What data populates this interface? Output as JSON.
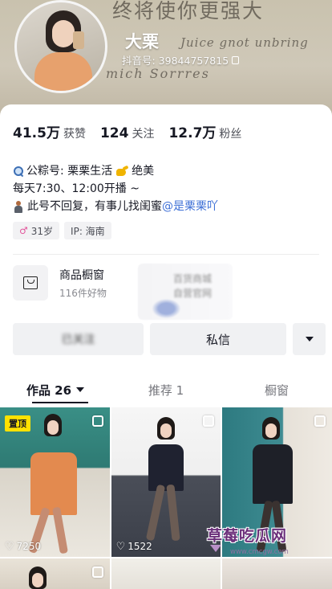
{
  "header": {
    "handwriting": [
      "终将使你更强大",
      "Juice gnot unbring",
      "mich Sorrres"
    ],
    "nickname": "大栗",
    "douyin_id": "抖音号: 39844757815"
  },
  "stats": [
    {
      "value": "41.5万",
      "label": "获赞"
    },
    {
      "value": "124",
      "label": "关注"
    },
    {
      "value": "12.7万",
      "label": "粉丝"
    }
  ],
  "bio": {
    "line1_text": "公粽号: 栗栗生活",
    "line1_tail": "绝美",
    "line2": "每天7:30、12:00开播 ~",
    "line3_text": "此号不回复，有事儿找闺蜜",
    "line3_mention": "@是栗栗吖"
  },
  "tags": {
    "age": "31岁",
    "ip": "IP: 海南",
    "gender_symbol": "♂"
  },
  "shop": {
    "title": "商品橱窗",
    "subtitle": "116件好物"
  },
  "blurred": {
    "box_lines": [
      "百货商城",
      "自营官网"
    ],
    "follow_text": "已关注"
  },
  "buttons": {
    "message": "私信"
  },
  "tabs": [
    {
      "label": "作品 26",
      "active": true
    },
    {
      "label": "推荐 1",
      "active": false
    },
    {
      "label": "橱窗",
      "active": false
    }
  ],
  "grid": [
    {
      "pinned_label": "置顶",
      "likes": "7250"
    },
    {
      "likes": "1522"
    },
    {
      "likes": ""
    }
  ],
  "watermark": {
    "title": "草莓吃瓜网",
    "url": "www.cmcgw.com"
  },
  "colors": {
    "mention": "#3d6fd6",
    "pin_badge": "#ffe100"
  }
}
